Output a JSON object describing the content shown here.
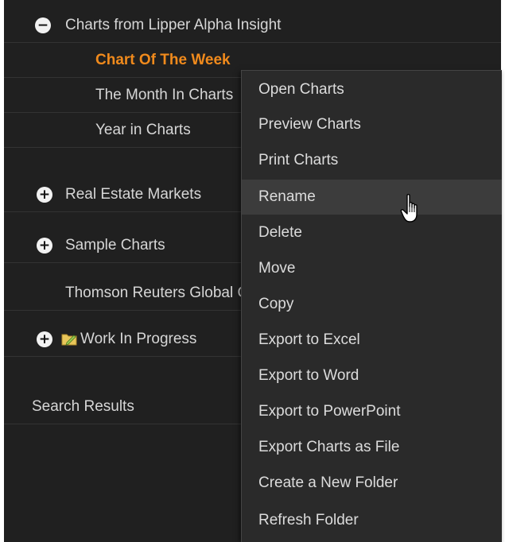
{
  "tree": {
    "items": [
      {
        "label": "Charts from Lipper Alpha Insight",
        "toggle": "−"
      },
      {
        "label": "Chart Of The Week",
        "state": "selected"
      },
      {
        "label": "The Month In Charts"
      },
      {
        "label": "Year in Charts"
      },
      {
        "label": "Real Estate Markets",
        "toggle": "+"
      },
      {
        "label": "Sample Charts",
        "toggle": "+"
      },
      {
        "label": "Thomson Reuters Global Charts"
      },
      {
        "label": "Work In Progress",
        "toggle": "+",
        "icon": "folder-edit-icon"
      },
      {
        "label": "Search Results"
      }
    ]
  },
  "context_menu": {
    "items": [
      {
        "label": "Open Charts"
      },
      {
        "label": "Preview Charts"
      },
      {
        "label": "Print Charts"
      },
      {
        "label": "Rename",
        "state": "hover"
      },
      {
        "label": "Delete"
      },
      {
        "label": "Move"
      },
      {
        "label": "Copy"
      },
      {
        "label": "Export to Excel"
      },
      {
        "label": "Export to Word"
      },
      {
        "label": "Export to PowerPoint"
      },
      {
        "label": "Export Charts as File"
      },
      {
        "label": "Create a New Folder"
      },
      {
        "label": "Refresh Folder"
      }
    ]
  },
  "colors": {
    "panel_background": "#202020",
    "menu_background": "#2a2a2a",
    "selected_text": "#f08a1c",
    "text": "#d6d6d6"
  },
  "cursor": "hand-pointer-icon"
}
